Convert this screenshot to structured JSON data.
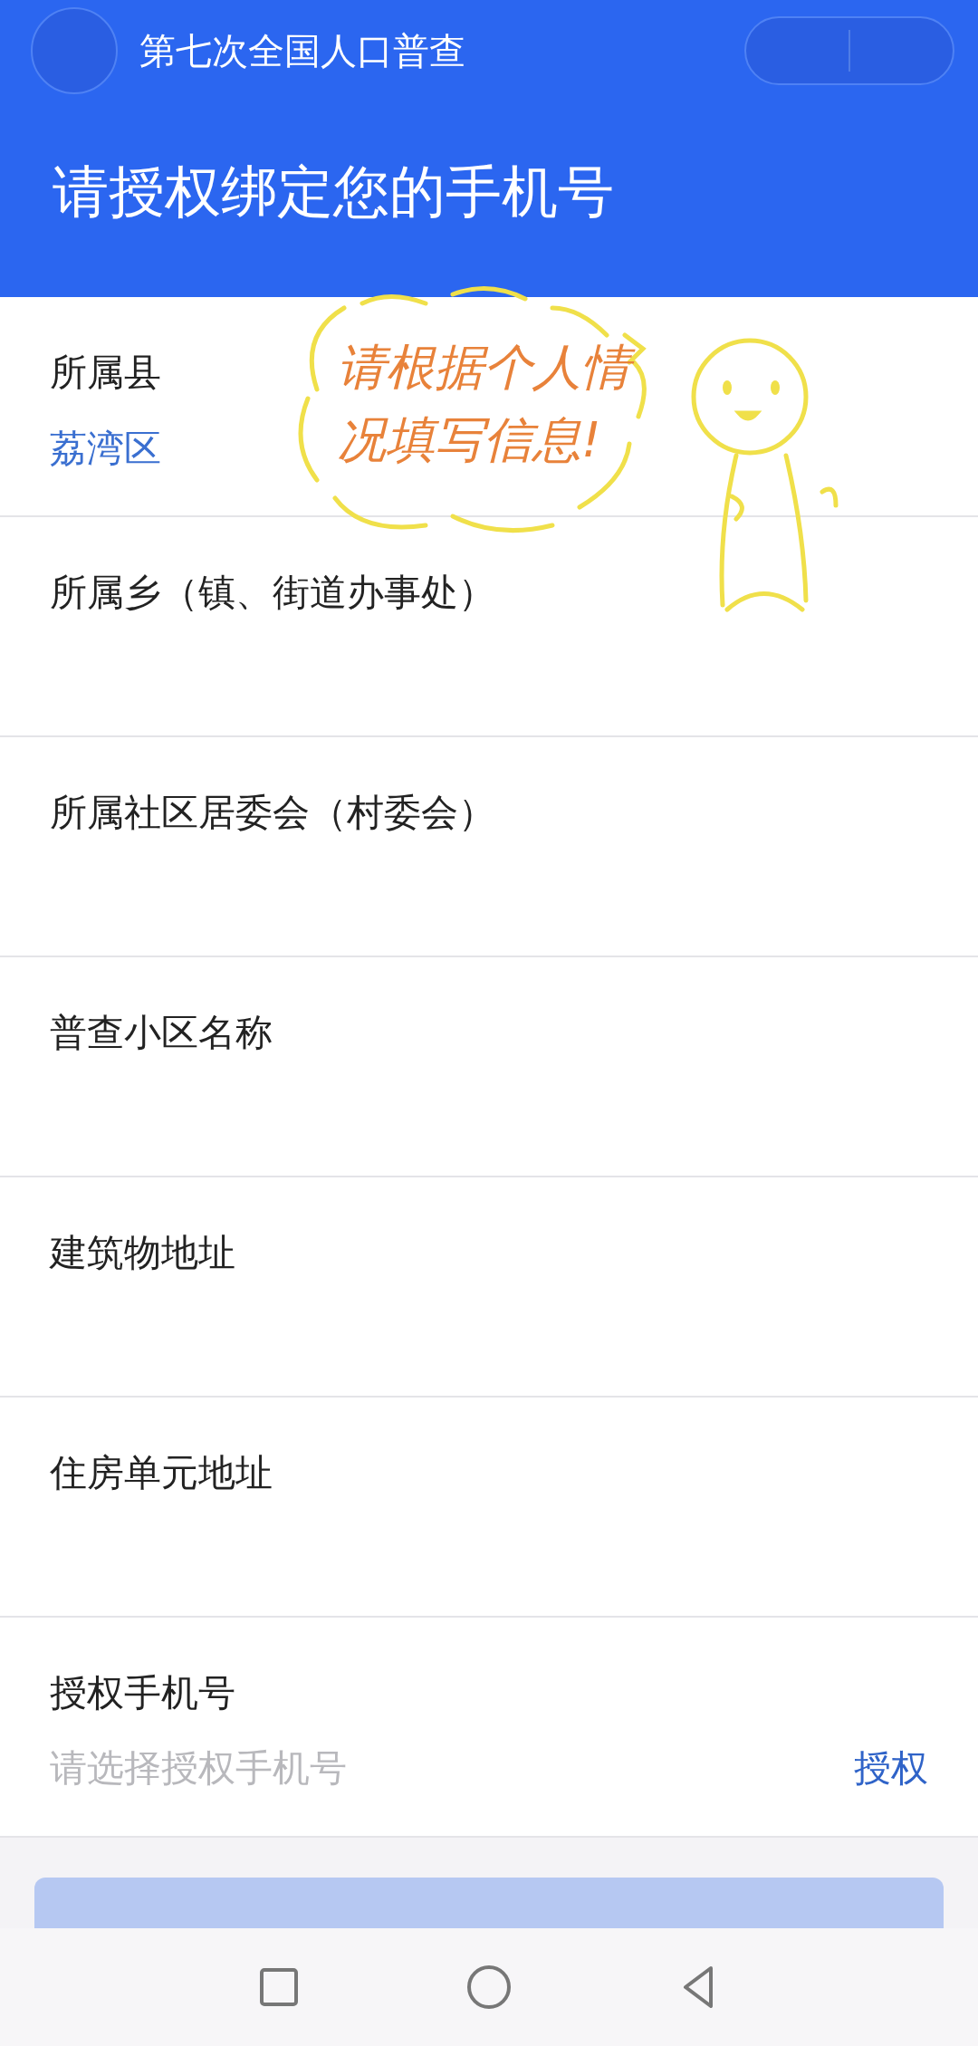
{
  "header": {
    "title": "第七次全国人口普查",
    "heading": "请授权绑定您的手机号"
  },
  "fields": [
    {
      "kind": "select",
      "label": "所属县",
      "value": "荔湾区"
    },
    {
      "kind": "select",
      "label": "所属乡（镇、街道办事处）"
    },
    {
      "kind": "select",
      "label": "所属社区居委会（村委会）"
    },
    {
      "kind": "select",
      "label": "普查小区名称"
    },
    {
      "kind": "select",
      "label": "建筑物地址"
    },
    {
      "kind": "select",
      "label": "住房单元地址"
    },
    {
      "kind": "phone",
      "label": "授权手机号",
      "placeholder": "请选择授权手机号",
      "action": "授权"
    }
  ],
  "annotation": {
    "text": "请根据个人情况填写信息!"
  },
  "submit": {
    "disabled": true
  }
}
